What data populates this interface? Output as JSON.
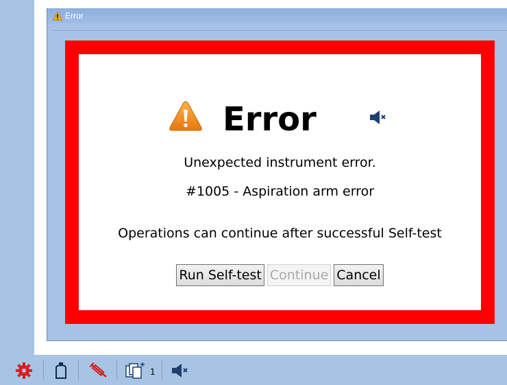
{
  "window": {
    "title": "Error",
    "title_icon": "warning-icon"
  },
  "dialog": {
    "heading": "Error",
    "heading_icon": "warning-icon",
    "sound_icon": "speaker-muted-icon",
    "message_line1": "Unexpected instrument error.",
    "message_line2": "#1005 - Aspiration arm error",
    "message_line3": "Operations can continue after successful Self-test",
    "buttons": {
      "run_selftest": "Run Self-test",
      "continue": "Continue",
      "cancel": "Cancel"
    },
    "continue_enabled": false
  },
  "taskbar": {
    "items": [
      {
        "icon": "gear-icon"
      },
      {
        "icon": "bottle-icon"
      },
      {
        "icon": "syringe-disabled-icon"
      },
      {
        "icon": "documents-icon",
        "count": "1"
      },
      {
        "icon": "speaker-muted-icon"
      }
    ]
  },
  "colors": {
    "panel_border": "#ff0000",
    "window_background": "#a6c3e6",
    "taskbar_background": "#a7c4e4",
    "warning_orange": "#f39a1e"
  }
}
